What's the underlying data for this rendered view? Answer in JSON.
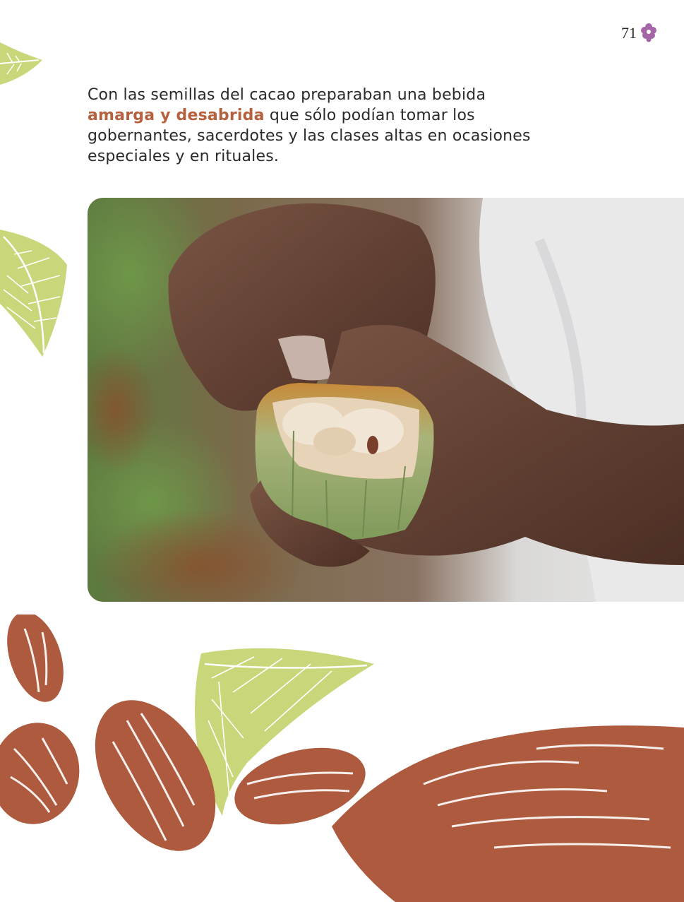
{
  "page": {
    "number": "71"
  },
  "paragraph": {
    "before": "Con las semillas del cacao preparaban una bebida ",
    "highlight": "amarga y desabrida",
    "after": " que sólo podían tomar los gobernantes, sacerdotes y las clases altas en ocasiones especiales y en rituales."
  },
  "colors": {
    "highlight": "#b5603e",
    "cacao_brown": "#ad5a3e",
    "leaf_green": "#c9d77a",
    "flower_purple": "#a566a8"
  },
  "icons": [
    "flower-icon",
    "cacao-leaf",
    "cacao-bean",
    "cacao-pod"
  ]
}
